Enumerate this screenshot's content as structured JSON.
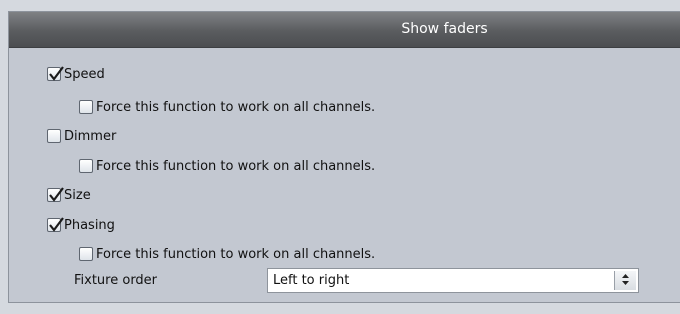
{
  "panel": {
    "title": "Show faders",
    "options": [
      {
        "label": "Speed",
        "checked": true
      },
      {
        "label": "Force this function to work on all channels.",
        "checked": false
      },
      {
        "label": "Dimmer",
        "checked": false
      },
      {
        "label": "Force this function to work on all channels.",
        "checked": false
      },
      {
        "label": "Size",
        "checked": true
      },
      {
        "label": "Phasing",
        "checked": true
      },
      {
        "label": "Force this function to work on all channels.",
        "checked": false
      }
    ],
    "fixture_order": {
      "label": "Fixture order",
      "value": "Left to right"
    }
  }
}
